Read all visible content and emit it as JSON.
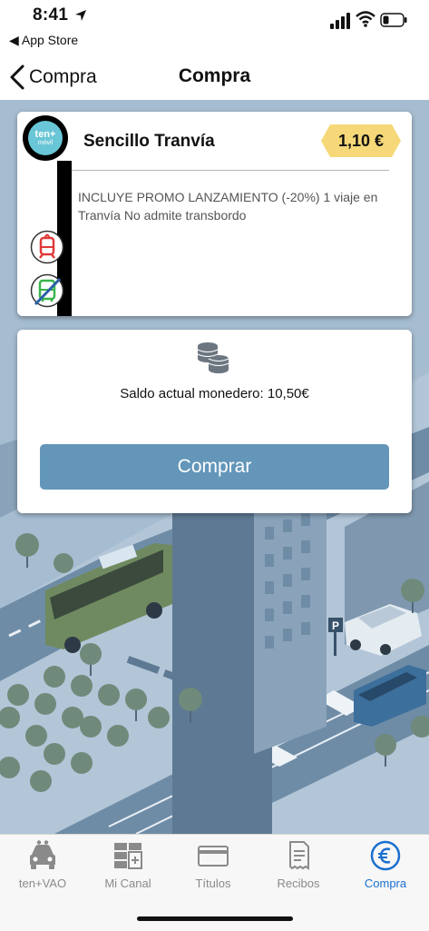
{
  "status_bar": {
    "time": "8:41",
    "back_app_label": "◀ App Store",
    "icons": [
      "location-arrow-icon",
      "signal-icon",
      "wifi-icon",
      "battery-icon"
    ]
  },
  "nav": {
    "back_label": "Compra",
    "title": "Compra"
  },
  "ticket": {
    "logo_main": "ten+",
    "logo_sub": "móvil",
    "name": "Sencillo Tranvía",
    "price": "1,10 €",
    "description": "INCLUYE PROMO LANZAMIENTO (-20%) 1 viaje en Tranvía No admite transbordo",
    "mode_icons": [
      "tram-icon",
      "bus-not-allowed-icon"
    ]
  },
  "wallet": {
    "icon": "coins-icon",
    "balance_text": "Saldo actual monedero: 10,50€",
    "buy_button_label": "Comprar"
  },
  "tabbar": {
    "items": [
      {
        "label": "ten+VAO",
        "icon": "car-icon",
        "active": false
      },
      {
        "label": "Mi Canal",
        "icon": "grid-icon",
        "active": false
      },
      {
        "label": "Títulos",
        "icon": "card-icon",
        "active": false
      },
      {
        "label": "Recibos",
        "icon": "receipt-icon",
        "active": false
      },
      {
        "label": "Compra",
        "icon": "euro-icon",
        "active": true
      }
    ]
  },
  "colors": {
    "accent": "#1a6fd0",
    "button": "#6396b9",
    "price_badge": "#f6d878",
    "logo": "#69c6d6",
    "scene_bg": "#a5bcd0"
  }
}
